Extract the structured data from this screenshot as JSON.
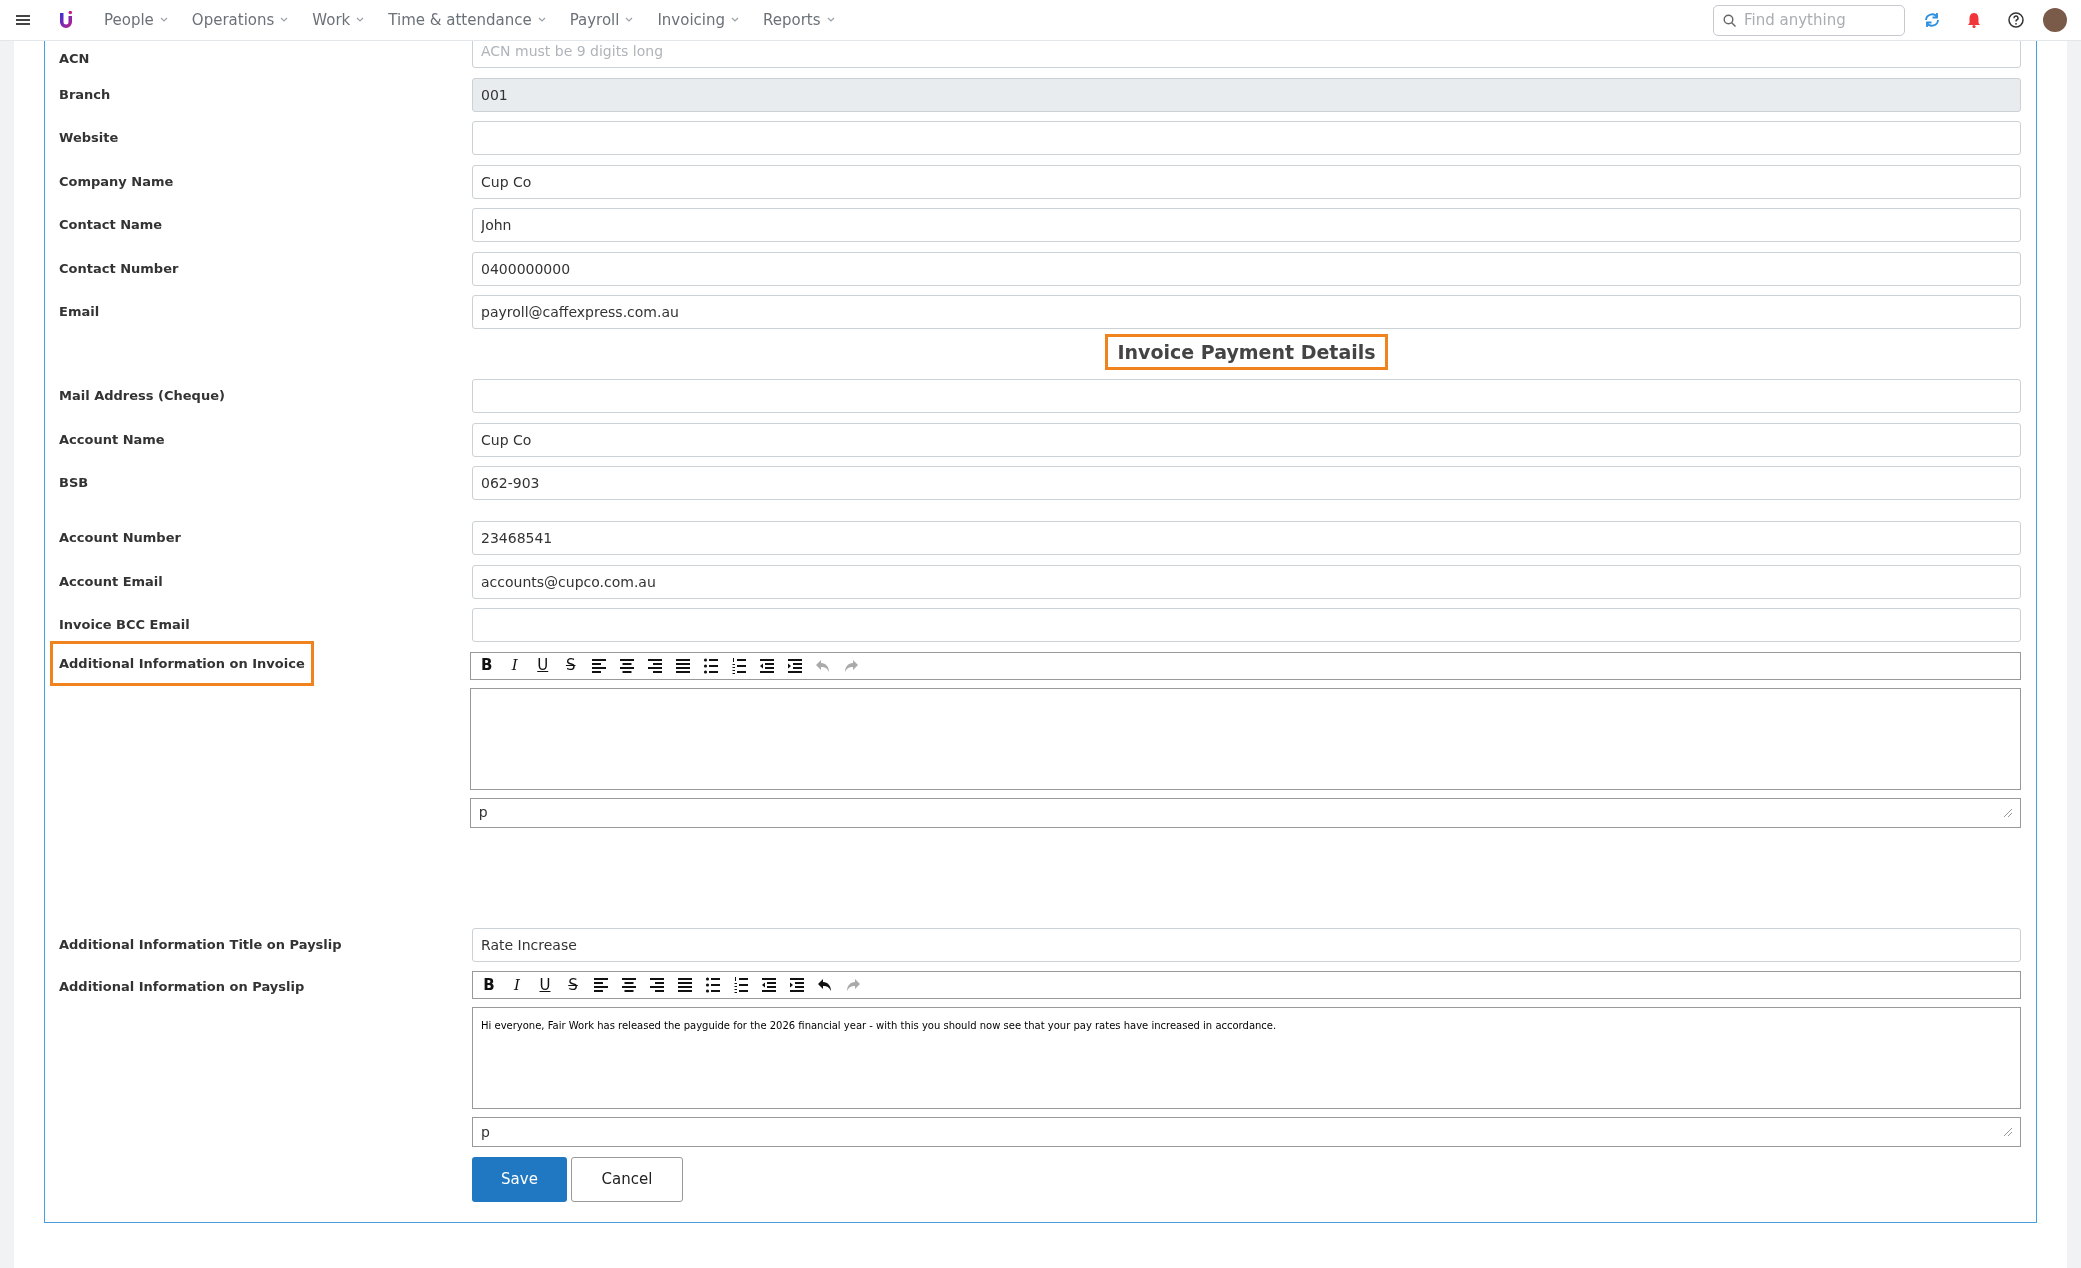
{
  "nav": {
    "menu": [
      {
        "label": "People"
      },
      {
        "label": "Operations"
      },
      {
        "label": "Work"
      },
      {
        "label": "Time & attendance"
      },
      {
        "label": "Payroll"
      },
      {
        "label": "Invoicing"
      },
      {
        "label": "Reports"
      }
    ],
    "search": {
      "placeholder": "Find anything"
    }
  },
  "form": {
    "fields": [
      {
        "kind": "input",
        "label": "ACN",
        "placeholder": "ACN must be 9 digits long",
        "disabled": false
      },
      {
        "kind": "input",
        "label": "Branch",
        "value": "001",
        "disabled": true
      },
      {
        "kind": "input",
        "label": "Website",
        "disabled": false
      },
      {
        "kind": "input",
        "label": "Company Name",
        "value": "Cup Co",
        "disabled": false
      },
      {
        "kind": "input",
        "label": "Contact Name",
        "value": "John",
        "disabled": false
      },
      {
        "kind": "input",
        "label": "Contact Number",
        "value": "0400000000",
        "disabled": false
      },
      {
        "kind": "input",
        "label": "Email",
        "value": "payroll@caffexpress.com.au",
        "disabled": false
      },
      {
        "kind": "heading",
        "label": "Invoice Payment Details",
        "highlighted": true
      },
      {
        "kind": "input",
        "label": "Mail Address (Cheque)",
        "disabled": false
      },
      {
        "kind": "input",
        "label": "Account Name",
        "value": "Cup Co",
        "disabled": false
      },
      {
        "kind": "input",
        "label": "BSB",
        "value": "062-903",
        "disabled": false
      },
      {
        "kind": "input",
        "label": "Account Number",
        "value": "23468541",
        "disabled": false
      },
      {
        "kind": "input",
        "label": "Account Email",
        "value": "accounts@cupco.com.au",
        "disabled": false
      },
      {
        "kind": "input",
        "label": "Invoice BCC Email",
        "disabled": false
      },
      {
        "kind": "editor",
        "label": "Additional Information on Invoice",
        "highlighted": true,
        "path": "p",
        "toolbar": [
          {
            "kind": "bold",
            "text": "B"
          },
          {
            "kind": "italic",
            "text": "I"
          },
          {
            "kind": "underline",
            "text": "U"
          },
          {
            "kind": "strike",
            "text": "S"
          },
          {
            "kind": "align-left"
          },
          {
            "kind": "align-center"
          },
          {
            "kind": "align-right"
          },
          {
            "kind": "justify"
          },
          {
            "kind": "bullets"
          },
          {
            "kind": "numbers"
          },
          {
            "kind": "outdent"
          },
          {
            "kind": "indent"
          },
          {
            "kind": "undo",
            "disabled": true
          },
          {
            "kind": "redo",
            "disabled": true
          }
        ]
      },
      {
        "kind": "input",
        "label": "Additional Information Title on Payslip",
        "value": "Rate Increase",
        "disabled": false
      },
      {
        "kind": "editor",
        "label": "Additional Information on Payslip",
        "highlighted": false,
        "content": "Hi everyone, Fair Work has released the payguide for the 2026 financial year - with this you should now see that your pay rates have increased in accordance.",
        "path": "p",
        "toolbar": [
          {
            "kind": "bold",
            "text": "B"
          },
          {
            "kind": "italic",
            "text": "I"
          },
          {
            "kind": "underline",
            "text": "U"
          },
          {
            "kind": "strike",
            "text": "S"
          },
          {
            "kind": "align-left"
          },
          {
            "kind": "align-center"
          },
          {
            "kind": "align-right"
          },
          {
            "kind": "justify"
          },
          {
            "kind": "bullets"
          },
          {
            "kind": "numbers"
          },
          {
            "kind": "outdent"
          },
          {
            "kind": "indent"
          },
          {
            "kind": "undo",
            "disabled": false
          },
          {
            "kind": "redo",
            "disabled": true
          }
        ]
      }
    ],
    "buttons": [
      {
        "kind": "primary",
        "label": "Save"
      },
      {
        "kind": "secondary",
        "label": "Cancel"
      }
    ]
  }
}
